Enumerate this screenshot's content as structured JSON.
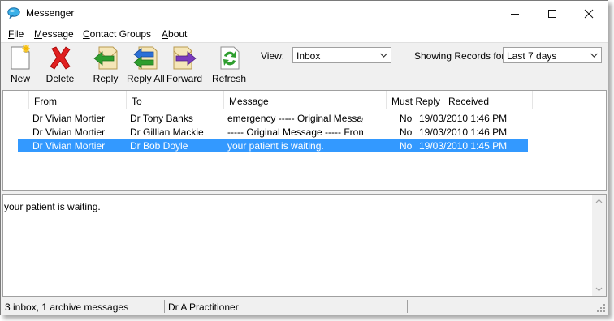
{
  "window": {
    "title": "Messenger",
    "icon": "speech-bubble-icon",
    "controls": [
      "minimize-icon",
      "maximize-icon",
      "close-icon"
    ]
  },
  "menu": [
    {
      "label": "File",
      "mnemonic": "F",
      "rest": "ile"
    },
    {
      "label": "Message",
      "mnemonic": "M",
      "rest": "essage"
    },
    {
      "label": "Contact Groups",
      "mnemonic": "C",
      "rest": "ontact Groups"
    },
    {
      "label": "About",
      "mnemonic": "A",
      "rest": "bout"
    }
  ],
  "toolbar": {
    "new_label": "New",
    "delete_label": "Delete",
    "reply_label": "Reply",
    "reply_all_label": "Reply All",
    "forward_label": "Forward",
    "refresh_label": "Refresh",
    "view_label": "View:",
    "view_value": "Inbox",
    "showing_label": "Showing Records for:",
    "showing_value": "Last 7 days"
  },
  "list": {
    "columns": [
      "From",
      "To",
      "Message",
      "Must Reply",
      "Received"
    ],
    "rows": [
      {
        "from": "Dr Vivian Mortier",
        "to": "Dr Tony Banks",
        "message": "emergency  ----- Original Message --",
        "must_reply": "No",
        "received": "19/03/2010 1:46 PM",
        "selected": false
      },
      {
        "from": "Dr Vivian Mortier",
        "to": "Dr Gillian Mackie",
        "message": "  ----- Original Message ----- From: Al",
        "must_reply": "No",
        "received": "19/03/2010 1:46 PM",
        "selected": false
      },
      {
        "from": "Dr Vivian Mortier",
        "to": "Dr Bob Doyle",
        "message": "your patient is waiting.",
        "must_reply": "No",
        "received": "19/03/2010 1:45 PM",
        "selected": true
      }
    ]
  },
  "preview": {
    "text": "your patient is waiting."
  },
  "status": {
    "counts": "3 inbox, 1 archive messages",
    "user": "Dr A Practitioner"
  },
  "colors": {
    "selection": "#3399ff",
    "delete_red": "#e02020",
    "reply_green": "#2e9e2e",
    "reply_all_blue": "#2a6fd6",
    "forward_purple": "#7a3bbd"
  }
}
